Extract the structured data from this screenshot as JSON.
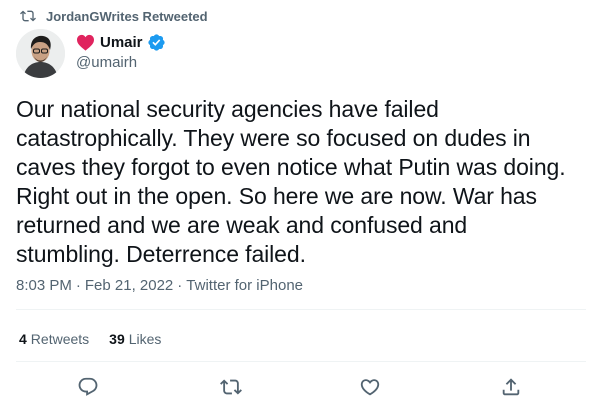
{
  "retweet_header": {
    "text": "JordanGWrites Retweeted",
    "icon": "retweet-icon"
  },
  "author": {
    "emoji_icon": "red-heart-icon",
    "display_name": "Umair",
    "verified_icon": "verified-badge-icon",
    "handle": "@umairh"
  },
  "tweet": {
    "lines": [
      "Our national security agencies have failed",
      "catastrophically. They were so focused on dudes in",
      "caves they forgot to even notice what Putin was doing.",
      "Right out in the open. So here we are now. War has",
      "returned and we are weak and confused and",
      "stumbling. Deterrence failed."
    ]
  },
  "meta": {
    "time": "8:03 PM",
    "separator": "·",
    "date": "Feb 21, 2022",
    "source": "Twitter for iPhone"
  },
  "stats": {
    "retweets_count": "4",
    "retweets_label": "Retweets",
    "likes_count": "39",
    "likes_label": "Likes"
  },
  "actions": {
    "reply": "reply-icon",
    "retweet": "retweet-icon",
    "like": "like-icon",
    "share": "share-icon"
  },
  "colors": {
    "text_primary": "#0f1419",
    "text_secondary": "#536471",
    "verified_blue": "#1d9bf0",
    "heart_red": "#e0245e",
    "divider": "#eff3f4"
  }
}
